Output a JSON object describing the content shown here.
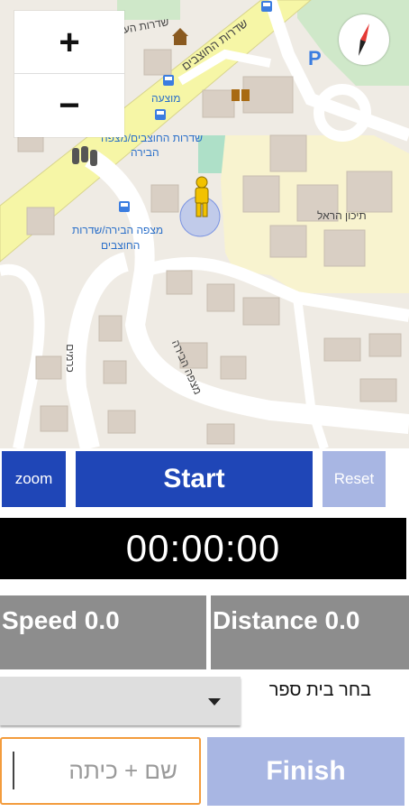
{
  "map": {
    "labels": {
      "street_top": "שדרות העצ",
      "street_main": "שדרות החוצבים",
      "museum": "מוצעה",
      "stop_1": "שדרות החוצבים/מצפה",
      "stop_1b": "הבירה",
      "stop_2": "מצפה הבירה/שדרות",
      "stop_2b": "החוצבים",
      "school": "תיכון הראל",
      "street_mitzpe": "מצפה הבירה",
      "street_kramim": "כרמים"
    },
    "zoom_in": "+",
    "zoom_out": "−",
    "icons": [
      "compass-icon",
      "bus-stop-icon",
      "parking-icon",
      "library-icon",
      "traffic-light-icon",
      "person-marker-icon"
    ]
  },
  "controls": {
    "zoom_label": "zoom",
    "start_label": "Start",
    "reset_label": "Reset"
  },
  "timer": "00:00:00",
  "stats": {
    "speed": "Speed 0.0",
    "distance": "Distance 0.0"
  },
  "school_select": {
    "label": "בחר בית ספר",
    "selected": ""
  },
  "name_field": {
    "placeholder": "שם + כיתה",
    "value": ""
  },
  "finish_label": "Finish",
  "colors": {
    "primary": "#1f46b7",
    "disabled": "#a8b6e3",
    "stat_bg": "#8d8d8d",
    "timer_bg": "#000000",
    "input_border": "#f39c3d"
  }
}
